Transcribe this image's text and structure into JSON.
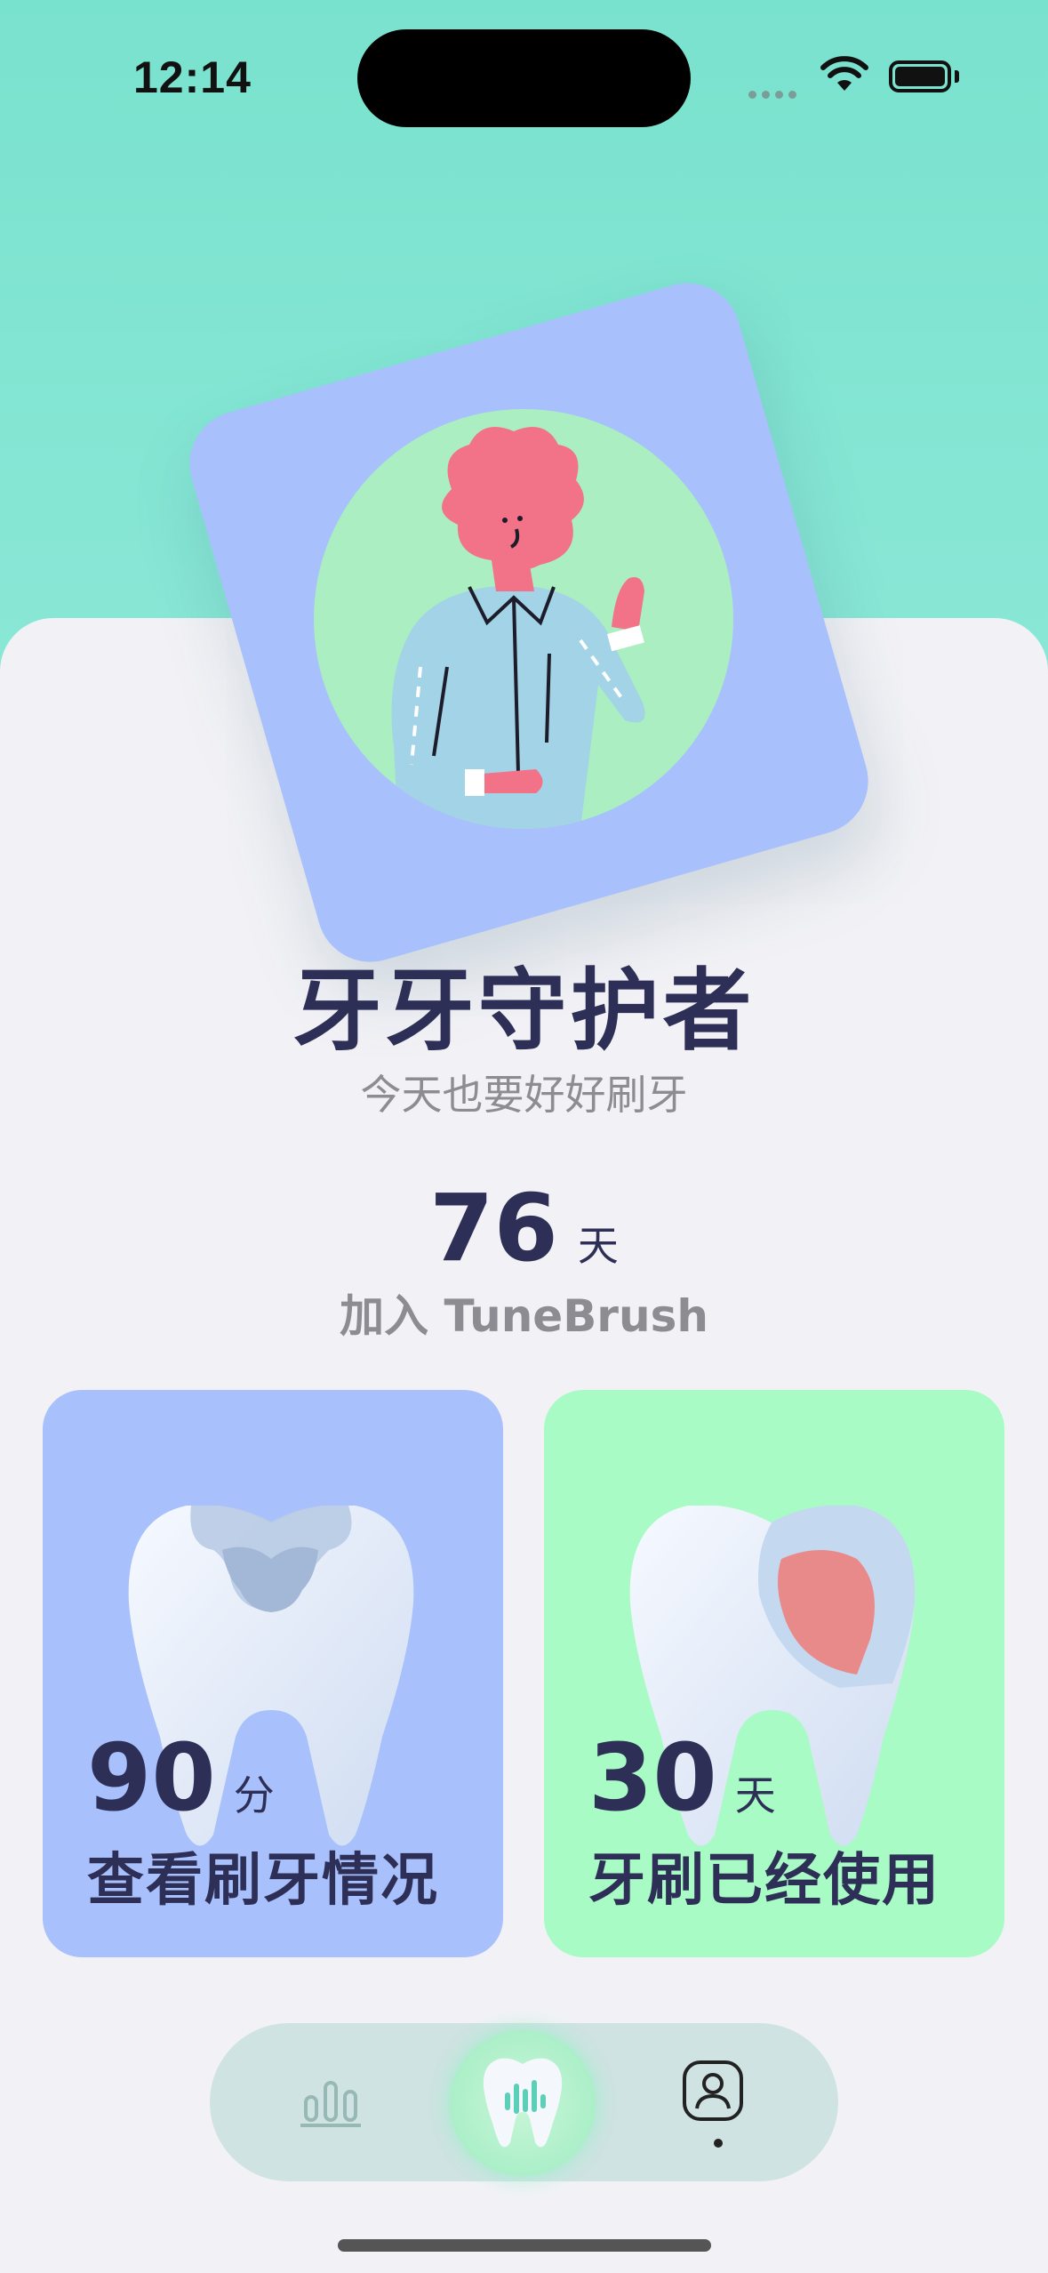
{
  "status_bar": {
    "time": "12:14"
  },
  "profile": {
    "title": "牙牙守护者",
    "subtitle": "今天也要好好刷牙",
    "days_count": "76",
    "days_unit": "天",
    "join_text": "加入 TuneBrush"
  },
  "cards": [
    {
      "value": "90",
      "unit": "分",
      "label": "查看刷牙情况",
      "color": "#a8c0fb",
      "icon": "tooth-cavity-icon"
    },
    {
      "value": "30",
      "unit": "天",
      "label": "牙刷已经使用",
      "color": "#a8fbc4",
      "icon": "tooth-cross-section-icon"
    }
  ],
  "tabbar": {
    "items": [
      {
        "icon": "stats-chart-icon"
      },
      {
        "icon": "tooth-brush-home-icon",
        "selected": true
      },
      {
        "icon": "profile-icon"
      }
    ]
  },
  "colors": {
    "accent": "#79e2ce",
    "text_dark": "#2e2f57",
    "text_muted": "#8c8c92"
  }
}
